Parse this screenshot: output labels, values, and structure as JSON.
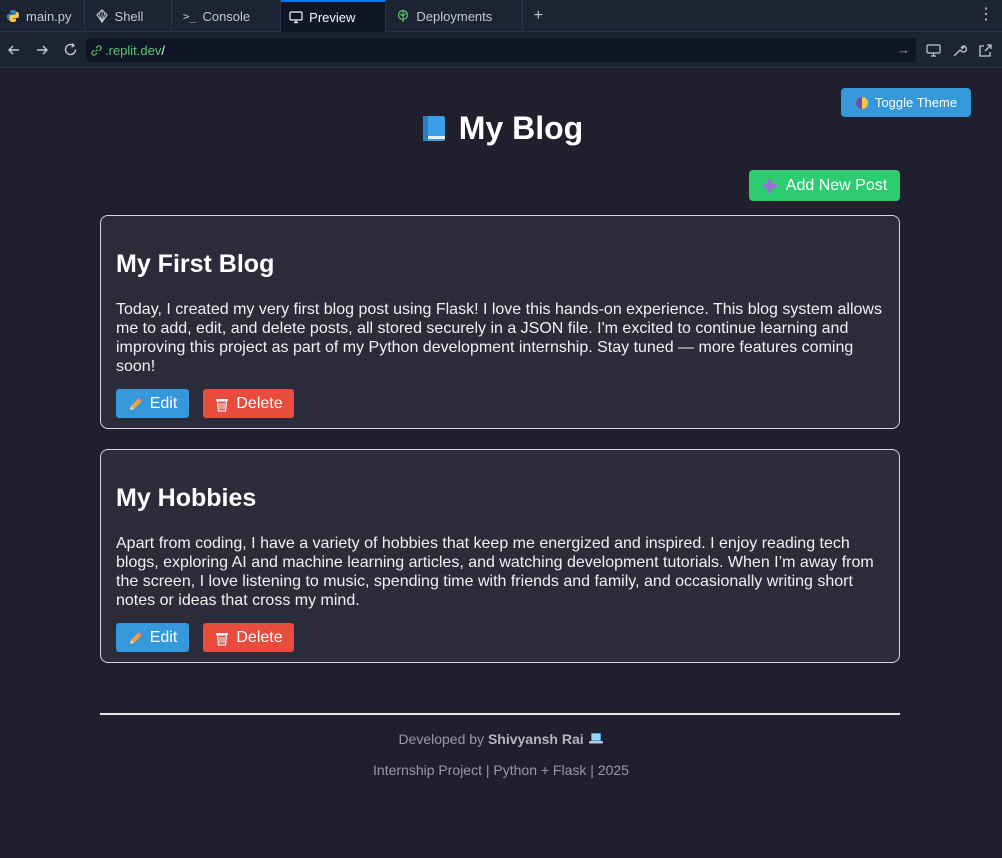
{
  "tabs": [
    {
      "label": "main.py",
      "icon": "python-icon"
    },
    {
      "label": "Shell",
      "icon": "shell-icon"
    },
    {
      "label": "Console",
      "icon": "console-icon"
    },
    {
      "label": "Preview",
      "icon": "preview-icon",
      "active": true
    },
    {
      "label": "Deployments",
      "icon": "deployments-icon"
    }
  ],
  "url": {
    "host": ".replit.dev",
    "path": "/"
  },
  "page": {
    "toggle_theme_label": "Toggle Theme",
    "title": "My Blog",
    "add_post_label": "Add New Post",
    "posts": [
      {
        "title": "My First Blog",
        "body": "Today, I created my very first blog post using Flask! I love this hands-on experience. This blog system allows me to add, edit, and delete posts, all stored securely in a JSON file. I'm excited to continue learning and improving this project as part of my Python development internship. Stay tuned — more features coming soon!",
        "edit_label": "Edit",
        "delete_label": "Delete"
      },
      {
        "title": "My Hobbies",
        "body": "Apart from coding, I have a variety of hobbies that keep me energized and inspired. I enjoy reading tech blogs, exploring AI and machine learning articles, and watching development tutorials. When I’m away from the screen, I love listening to music, spending time with friends and family, and occasionally writing short notes or ideas that cross my mind.",
        "edit_label": "Edit",
        "delete_label": "Delete"
      }
    ],
    "footer": {
      "developed_by_prefix": "Developed by",
      "developer_name": "Shivyansh Rai",
      "project_line": "Internship Project | Python + Flask | 2025"
    }
  },
  "colors": {
    "background": "#1f1f2e",
    "card": "#2b2b3a",
    "toggle": "#3498db",
    "add": "#2ecc71",
    "edit": "#3498db",
    "delete": "#e74c3c"
  }
}
